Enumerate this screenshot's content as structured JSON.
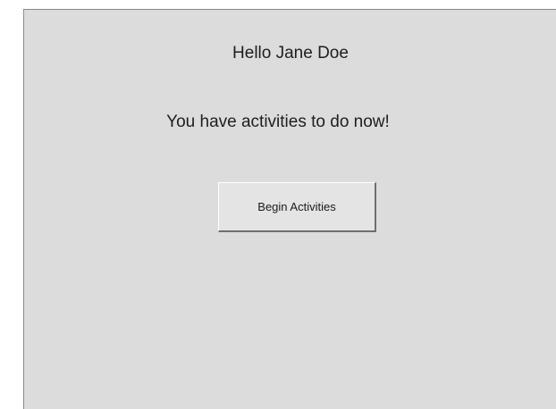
{
  "greeting": "Hello Jane Doe",
  "message": "You have activities to do now!",
  "actions": {
    "begin_label": "Begin Activities"
  }
}
